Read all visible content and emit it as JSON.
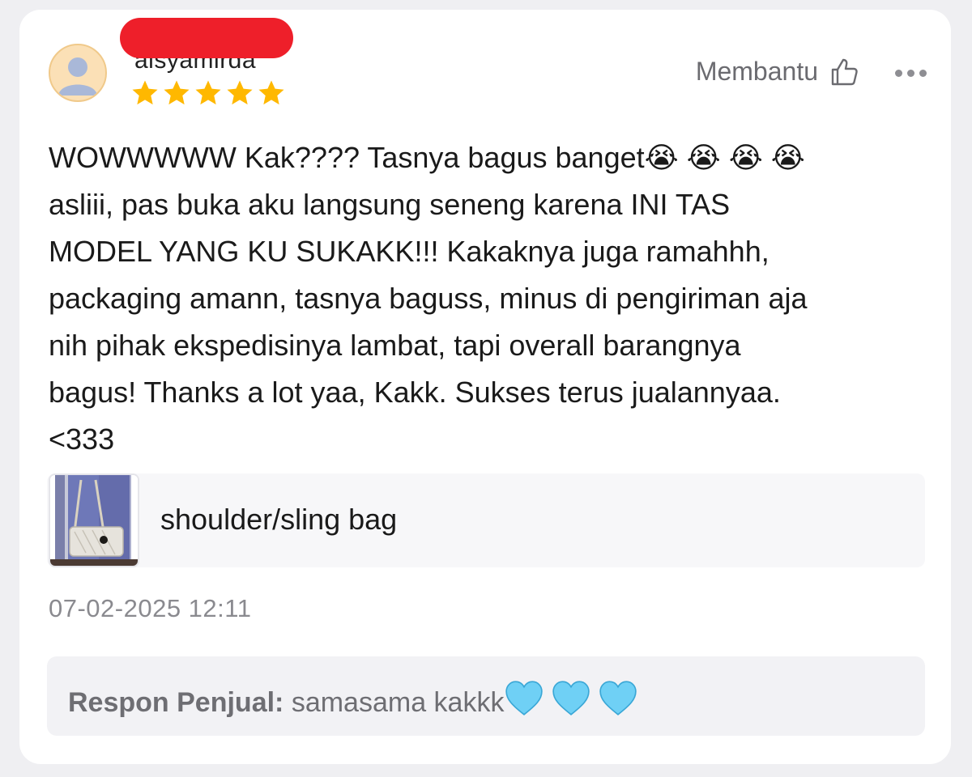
{
  "review": {
    "username": "alsyamirda",
    "rating": 5,
    "rating_max": 5,
    "helpful_label": "Membantu",
    "text": "WOWWWWW Kak???? Tasnya bagus banget😭 😭 😭 😭\nasliii, pas buka aku langsung seneng karena INI TAS\nMODEL YANG KU SUKAKK!!! Kakaknya juga ramahhh,\npackaging amann, tasnya baguss, minus di pengiriman aja\nnih pihak ekspedisinya lambat, tapi overall barangnya\nbagus! Thanks a lot yaa, Kakk. Sukses terus jualannyaa.\n<333",
    "product": {
      "name": "shoulder/sling bag"
    },
    "timestamp": "07-02-2025 12:11"
  },
  "seller_response": {
    "label": "Respon Penjual:",
    "text": "samasama kakkk",
    "emoji": [
      "light-blue-heart",
      "light-blue-heart",
      "light-blue-heart"
    ]
  },
  "icons": {
    "avatar": "person-icon",
    "helpful": "thumbs-up-icon",
    "more": "more-dots-icon",
    "star": "star-icon"
  },
  "colors": {
    "star": "#ffb800",
    "redaction": "#ee1f2a",
    "heart": "#6fd0f5",
    "avatar_bg": "#fbe0b6"
  }
}
